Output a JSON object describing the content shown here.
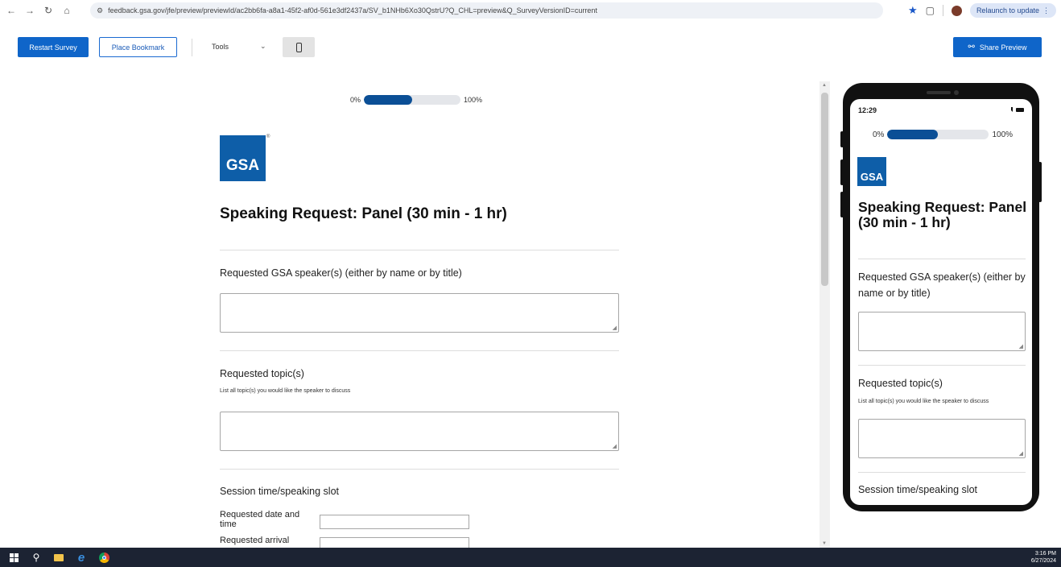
{
  "browser": {
    "url": "feedback.gsa.gov/jfe/preview/previewId/ac2bb6fa-a8a1-45f2-af0d-561e3df2437a/SV_b1NHb6Xo30QstrU?Q_CHL=preview&Q_SurveyVersionID=current",
    "relaunch_label": "Relaunch to update"
  },
  "toolbar": {
    "restart_label": "Restart Survey",
    "bookmark_label": "Place Bookmark",
    "tools_label": "Tools",
    "share_label": "Share Preview"
  },
  "survey": {
    "progress": {
      "start_label": "0%",
      "end_label": "100%",
      "fraction": 0.5
    },
    "logo_text": "GSA",
    "logo_mark": "®",
    "title": "Speaking Request: Panel (30 min - 1 hr)",
    "questions": [
      {
        "label": "Requested GSA speaker(s) (either by name or by title)",
        "help": ""
      },
      {
        "label": "Requested topic(s)",
        "help": "List all topic(s) you would like the speaker to discuss"
      },
      {
        "label": "Session time/speaking slot",
        "help": ""
      }
    ],
    "session_fields": [
      {
        "label": "Requested date and time"
      },
      {
        "label": "Requested arrival"
      }
    ]
  },
  "phone": {
    "time": "12:29"
  },
  "taskbar": {
    "time": "3:16 PM",
    "date": "6/27/2024"
  },
  "colors": {
    "primary": "#0f65c9",
    "progress_fill": "#0b4f96",
    "gsa_blue": "#0e5ea8",
    "taskbar": "#1c2333"
  }
}
